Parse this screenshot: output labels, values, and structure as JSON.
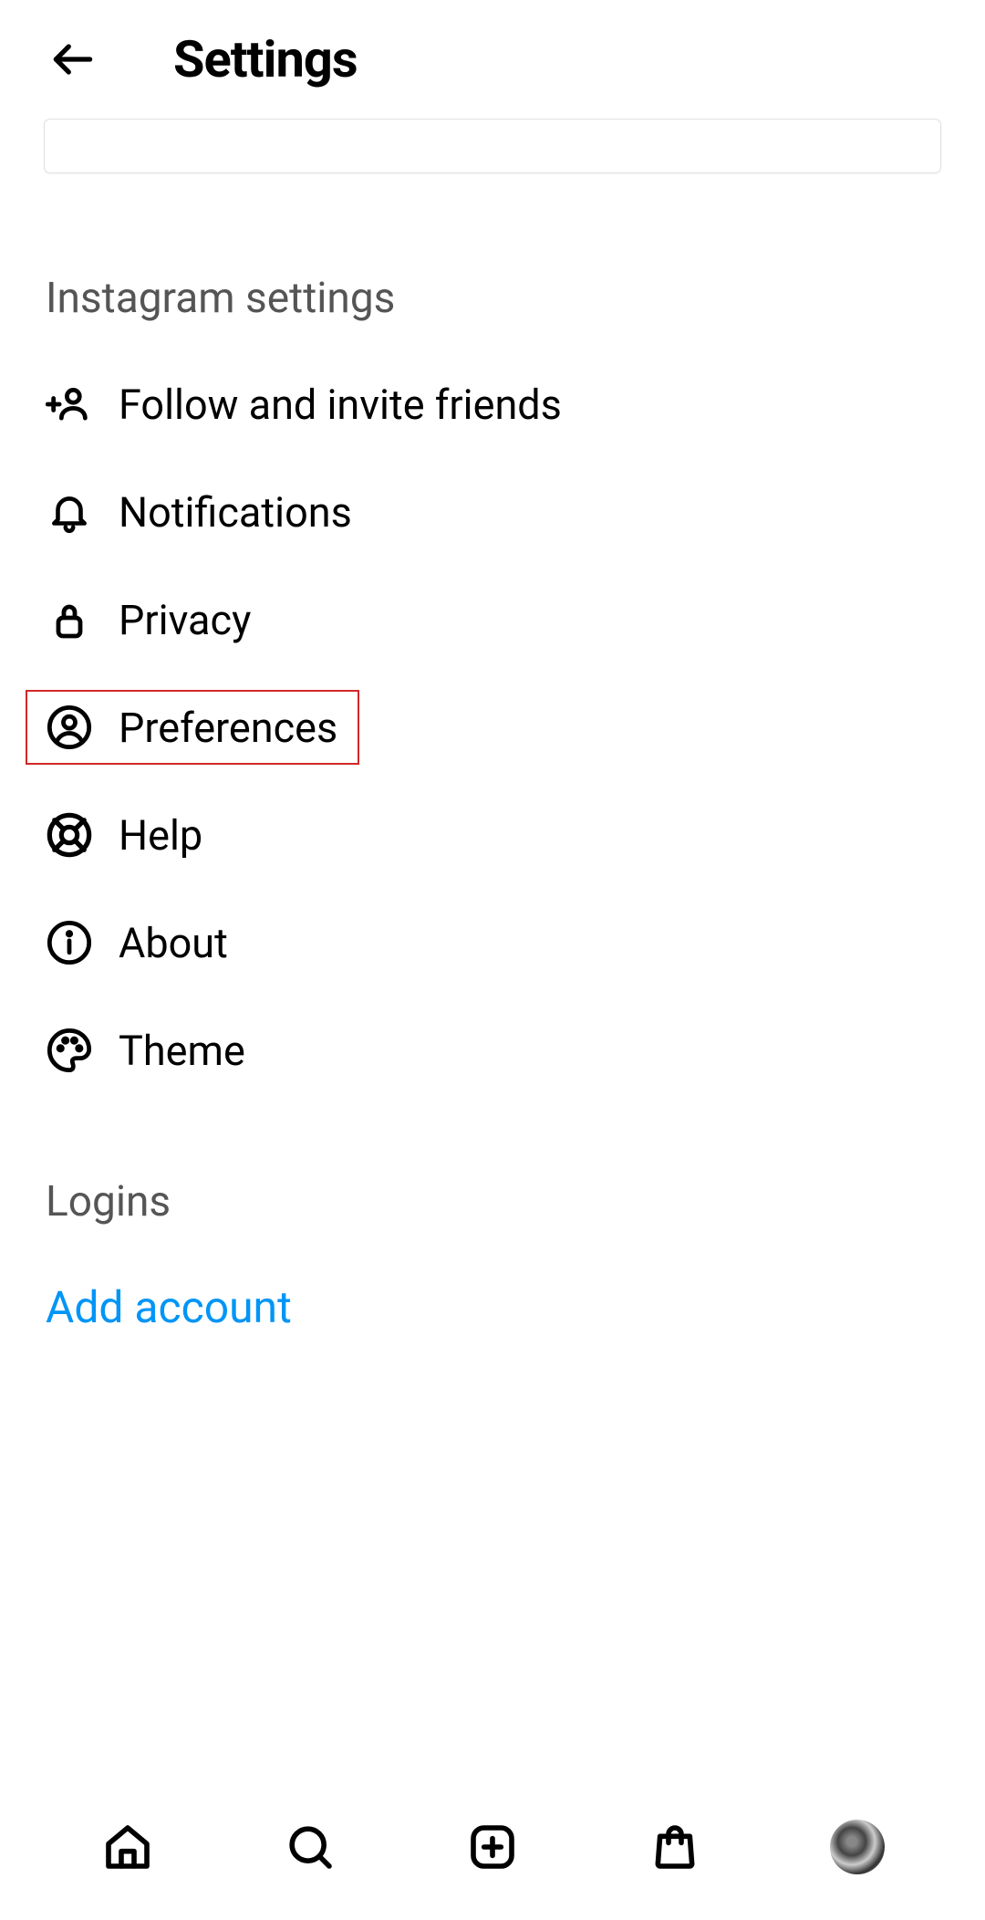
{
  "header": {
    "title": "Settings"
  },
  "sections": {
    "instagram_settings": "Instagram settings",
    "logins": "Logins"
  },
  "items": {
    "follow_invite": "Follow and invite friends",
    "notifications": "Notifications",
    "privacy": "Privacy",
    "preferences": "Preferences",
    "help": "Help",
    "about": "About",
    "theme": "Theme"
  },
  "actions": {
    "add_account": "Add account"
  }
}
